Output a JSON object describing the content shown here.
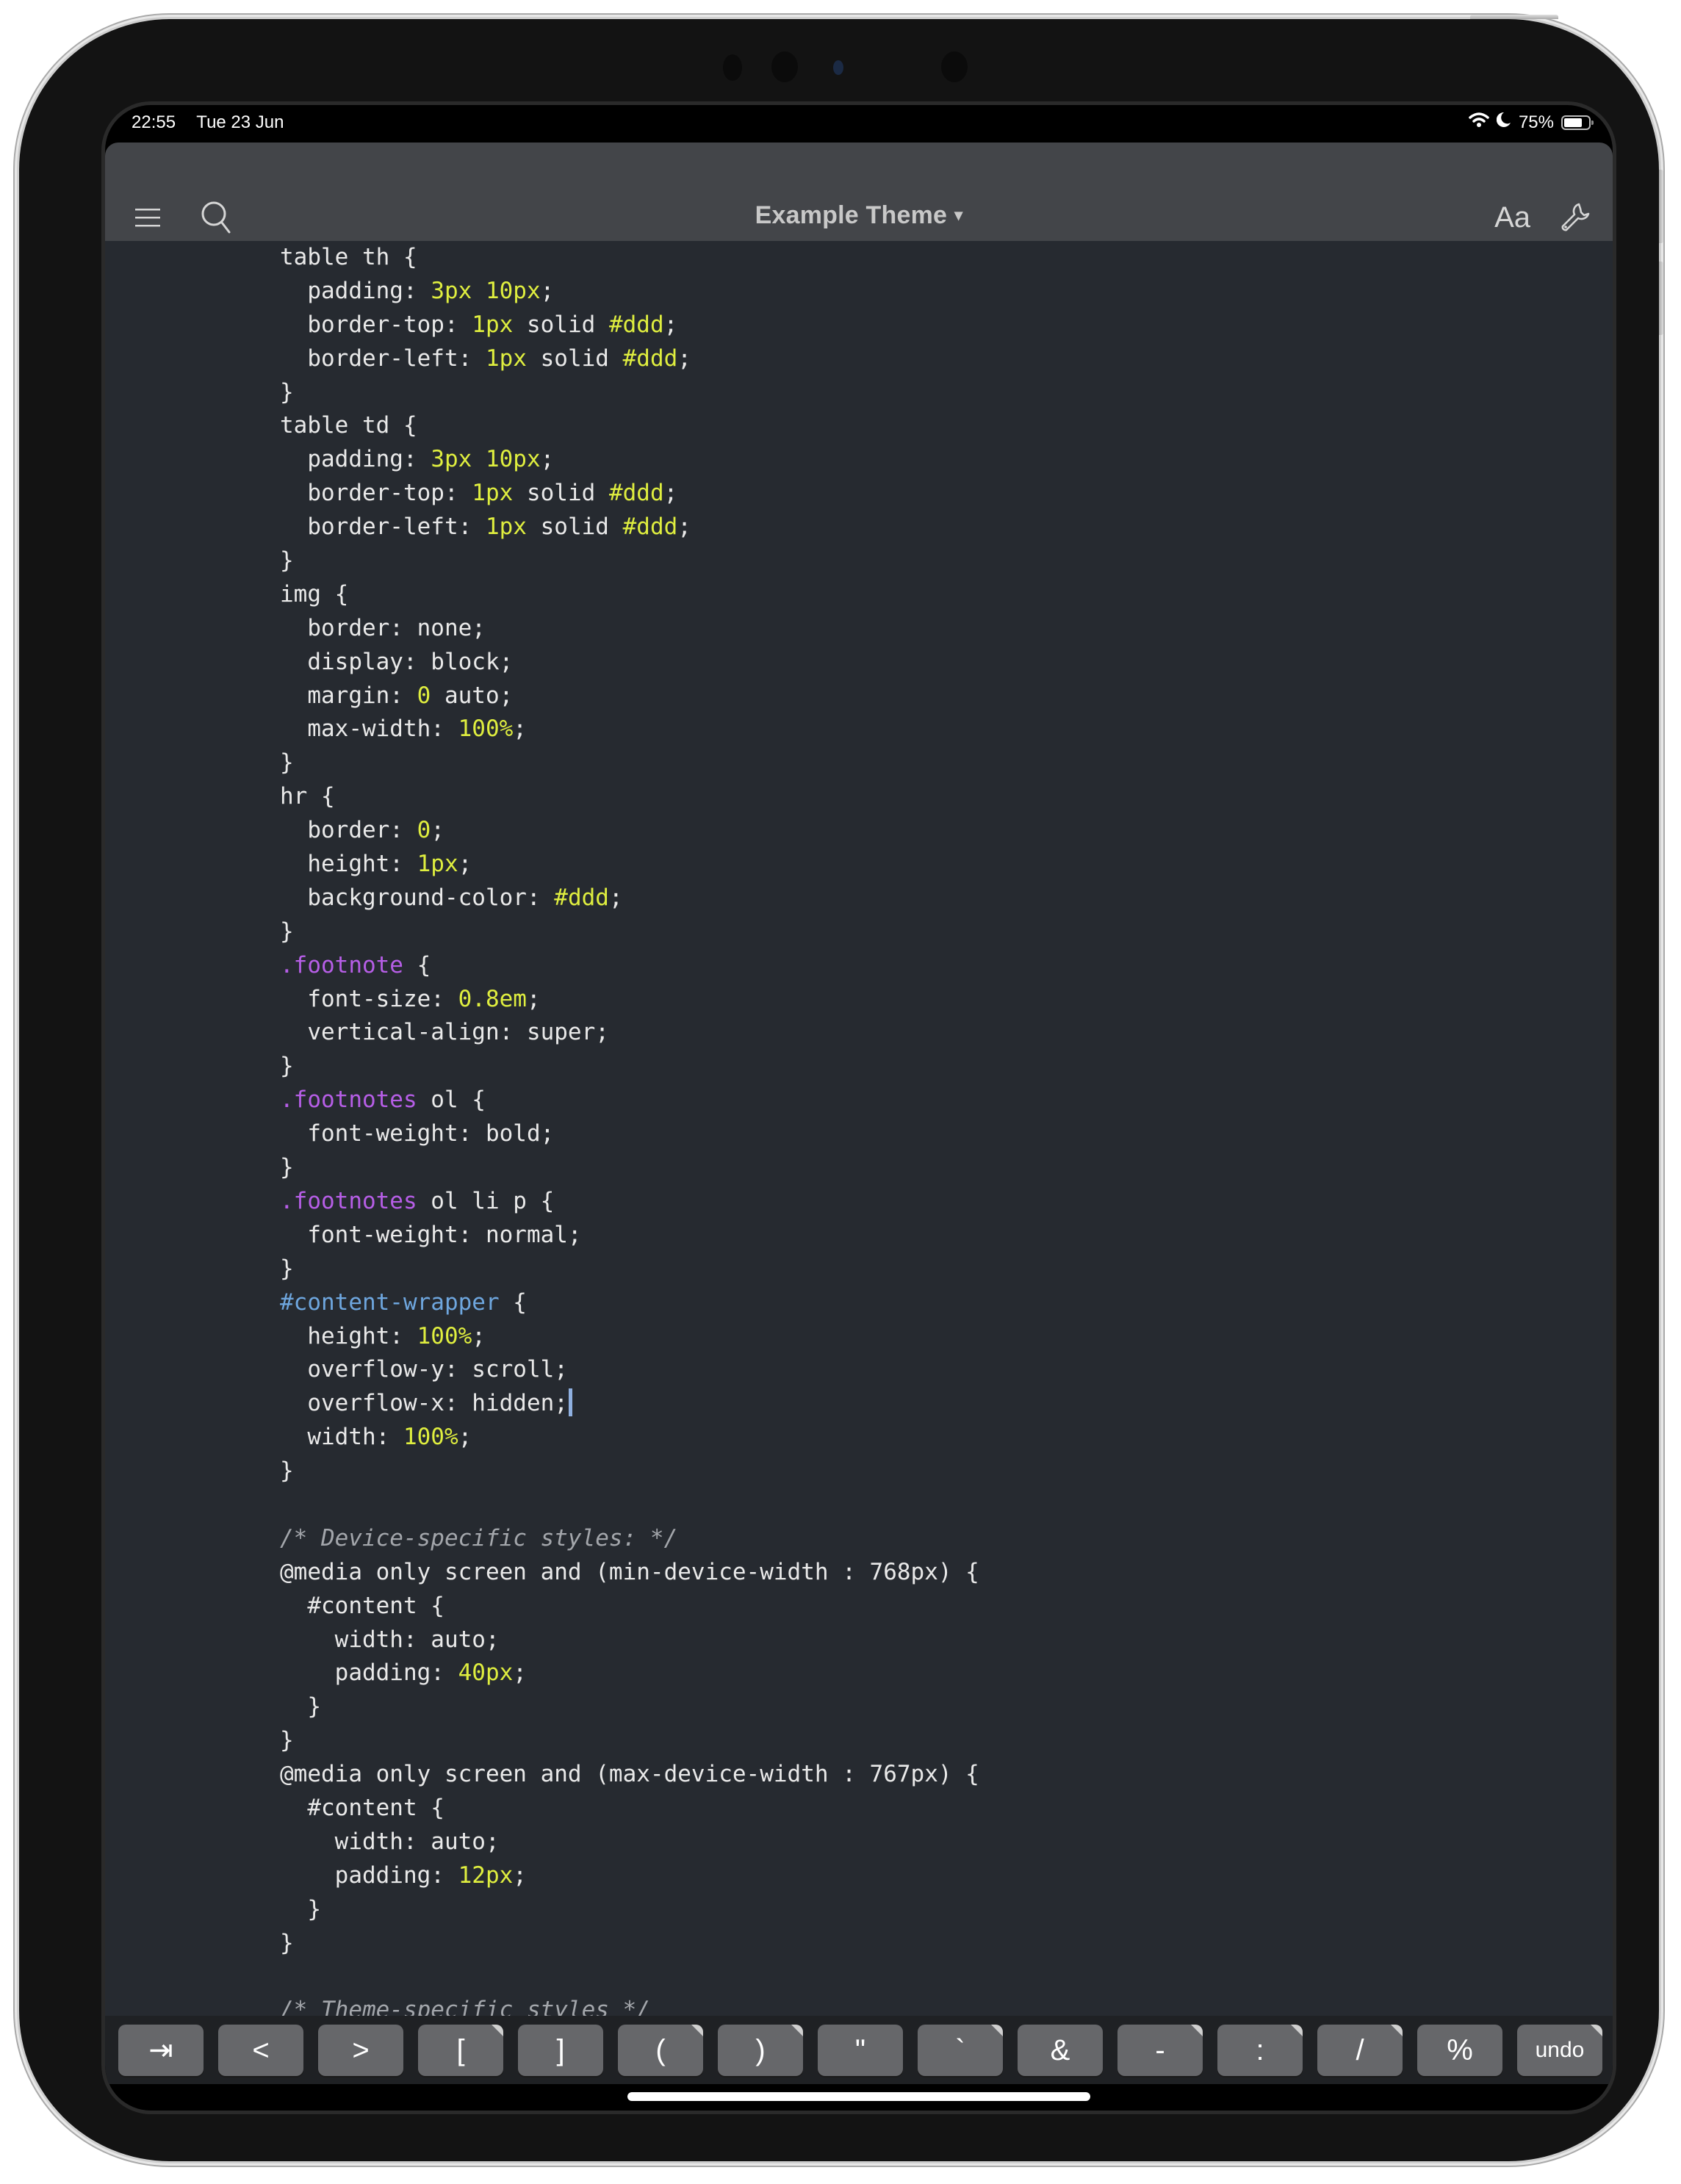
{
  "status_bar": {
    "time": "22:55",
    "date": "Tue 23 Jun",
    "battery_percent_label": "75%",
    "battery_level": 0.75,
    "icons": [
      "wifi-icon",
      "do-not-disturb-moon-icon",
      "battery-icon"
    ]
  },
  "toolbar": {
    "title": "Example Theme",
    "title_caret": "▾",
    "menu_icon": "hamburger-menu-icon",
    "search_icon": "search-icon",
    "font_button_label": "Aa",
    "settings_icon": "wrench-icon"
  },
  "editor": {
    "cursor_line": 35,
    "lines": [
      [
        {
          "t": "table th {",
          "c": "plain"
        }
      ],
      [
        {
          "t": "  padding: ",
          "c": "plain"
        },
        {
          "t": "3px 10px",
          "c": "num"
        },
        {
          "t": ";",
          "c": "plain"
        }
      ],
      [
        {
          "t": "  border-top: ",
          "c": "plain"
        },
        {
          "t": "1px",
          "c": "num"
        },
        {
          "t": " solid ",
          "c": "plain"
        },
        {
          "t": "#ddd",
          "c": "num"
        },
        {
          "t": ";",
          "c": "plain"
        }
      ],
      [
        {
          "t": "  border-left: ",
          "c": "plain"
        },
        {
          "t": "1px",
          "c": "num"
        },
        {
          "t": " solid ",
          "c": "plain"
        },
        {
          "t": "#ddd",
          "c": "num"
        },
        {
          "t": ";",
          "c": "plain"
        }
      ],
      [
        {
          "t": "}",
          "c": "plain"
        }
      ],
      [
        {
          "t": "table td {",
          "c": "plain"
        }
      ],
      [
        {
          "t": "  padding: ",
          "c": "plain"
        },
        {
          "t": "3px 10px",
          "c": "num"
        },
        {
          "t": ";",
          "c": "plain"
        }
      ],
      [
        {
          "t": "  border-top: ",
          "c": "plain"
        },
        {
          "t": "1px",
          "c": "num"
        },
        {
          "t": " solid ",
          "c": "plain"
        },
        {
          "t": "#ddd",
          "c": "num"
        },
        {
          "t": ";",
          "c": "plain"
        }
      ],
      [
        {
          "t": "  border-left: ",
          "c": "plain"
        },
        {
          "t": "1px",
          "c": "num"
        },
        {
          "t": " solid ",
          "c": "plain"
        },
        {
          "t": "#ddd",
          "c": "num"
        },
        {
          "t": ";",
          "c": "plain"
        }
      ],
      [
        {
          "t": "}",
          "c": "plain"
        }
      ],
      [
        {
          "t": "img {",
          "c": "plain"
        }
      ],
      [
        {
          "t": "  border: none;",
          "c": "plain"
        }
      ],
      [
        {
          "t": "  display: block;",
          "c": "plain"
        }
      ],
      [
        {
          "t": "  margin: ",
          "c": "plain"
        },
        {
          "t": "0",
          "c": "num"
        },
        {
          "t": " auto;",
          "c": "plain"
        }
      ],
      [
        {
          "t": "  max-width: ",
          "c": "plain"
        },
        {
          "t": "100%",
          "c": "num"
        },
        {
          "t": ";",
          "c": "plain"
        }
      ],
      [
        {
          "t": "}",
          "c": "plain"
        }
      ],
      [
        {
          "t": "hr {",
          "c": "plain"
        }
      ],
      [
        {
          "t": "  border: ",
          "c": "plain"
        },
        {
          "t": "0",
          "c": "num"
        },
        {
          "t": ";",
          "c": "plain"
        }
      ],
      [
        {
          "t": "  height: ",
          "c": "plain"
        },
        {
          "t": "1px",
          "c": "num"
        },
        {
          "t": ";",
          "c": "plain"
        }
      ],
      [
        {
          "t": "  background-color: ",
          "c": "plain"
        },
        {
          "t": "#ddd",
          "c": "num"
        },
        {
          "t": ";",
          "c": "plain"
        }
      ],
      [
        {
          "t": "}",
          "c": "plain"
        }
      ],
      [
        {
          "t": ".footnote",
          "c": "class"
        },
        {
          "t": " {",
          "c": "plain"
        }
      ],
      [
        {
          "t": "  font-size: ",
          "c": "plain"
        },
        {
          "t": "0.8em",
          "c": "num"
        },
        {
          "t": ";",
          "c": "plain"
        }
      ],
      [
        {
          "t": "  vertical-align: super;",
          "c": "plain"
        }
      ],
      [
        {
          "t": "}",
          "c": "plain"
        }
      ],
      [
        {
          "t": ".footnotes",
          "c": "class"
        },
        {
          "t": " ol {",
          "c": "plain"
        }
      ],
      [
        {
          "t": "  font-weight: bold;",
          "c": "plain"
        }
      ],
      [
        {
          "t": "}",
          "c": "plain"
        }
      ],
      [
        {
          "t": ".footnotes",
          "c": "class"
        },
        {
          "t": " ol li p {",
          "c": "plain"
        }
      ],
      [
        {
          "t": "  font-weight: normal;",
          "c": "plain"
        }
      ],
      [
        {
          "t": "}",
          "c": "plain"
        }
      ],
      [
        {
          "t": "#content-wrapper",
          "c": "id"
        },
        {
          "t": " {",
          "c": "plain"
        }
      ],
      [
        {
          "t": "  height: ",
          "c": "plain"
        },
        {
          "t": "100%",
          "c": "num"
        },
        {
          "t": ";",
          "c": "plain"
        }
      ],
      [
        {
          "t": "  overflow-y: scroll;",
          "c": "plain"
        }
      ],
      [
        {
          "t": "  overflow-x: hidden;",
          "c": "plain"
        }
      ],
      [
        {
          "t": "  width: ",
          "c": "plain"
        },
        {
          "t": "100%",
          "c": "num"
        },
        {
          "t": ";",
          "c": "plain"
        }
      ],
      [
        {
          "t": "}",
          "c": "plain"
        }
      ],
      [],
      [
        {
          "t": "/* Device-specific styles: */",
          "c": "comment"
        }
      ],
      [
        {
          "t": "@media only screen and (min-device-width : 768px) {",
          "c": "plain"
        }
      ],
      [
        {
          "t": "  #content {",
          "c": "plain"
        }
      ],
      [
        {
          "t": "    width: auto;",
          "c": "plain"
        }
      ],
      [
        {
          "t": "    padding: ",
          "c": "plain"
        },
        {
          "t": "40px",
          "c": "num"
        },
        {
          "t": ";",
          "c": "plain"
        }
      ],
      [
        {
          "t": "  }",
          "c": "plain"
        }
      ],
      [
        {
          "t": "}",
          "c": "plain"
        }
      ],
      [
        {
          "t": "@media only screen and (max-device-width : 767px) {",
          "c": "plain"
        }
      ],
      [
        {
          "t": "  #content {",
          "c": "plain"
        }
      ],
      [
        {
          "t": "    width: auto;",
          "c": "plain"
        }
      ],
      [
        {
          "t": "    padding: ",
          "c": "plain"
        },
        {
          "t": "12px",
          "c": "num"
        },
        {
          "t": ";",
          "c": "plain"
        }
      ],
      [
        {
          "t": "  }",
          "c": "plain"
        }
      ],
      [
        {
          "t": "}",
          "c": "plain"
        }
      ],
      [],
      [
        {
          "t": "/* Theme-specific styles */",
          "c": "comment"
        }
      ]
    ]
  },
  "keyboard_bar": {
    "keys": [
      {
        "label": "⇥",
        "name": "tab-key",
        "alt": false
      },
      {
        "label": "<",
        "name": "less-than-key",
        "alt": false
      },
      {
        "label": ">",
        "name": "greater-than-key",
        "alt": false
      },
      {
        "label": "[",
        "name": "open-bracket-key",
        "alt": true
      },
      {
        "label": "]",
        "name": "close-bracket-key",
        "alt": false
      },
      {
        "label": "(",
        "name": "open-paren-key",
        "alt": true
      },
      {
        "label": ")",
        "name": "close-paren-key",
        "alt": true
      },
      {
        "label": "\"",
        "name": "double-quote-key",
        "alt": false
      },
      {
        "label": "`",
        "name": "backtick-key",
        "alt": true
      },
      {
        "label": "&",
        "name": "ampersand-key",
        "alt": false
      },
      {
        "label": "-",
        "name": "hyphen-key",
        "alt": true
      },
      {
        "label": ":",
        "name": "colon-key",
        "alt": true
      },
      {
        "label": "/",
        "name": "slash-key",
        "alt": true
      },
      {
        "label": "%",
        "name": "percent-key",
        "alt": false
      },
      {
        "label": "undo",
        "name": "undo-key",
        "alt": true
      }
    ]
  },
  "colors": {
    "editor_bg": "#262a30",
    "toolbar_bg": "#434549",
    "text": "#e9e9e9",
    "number": "#dfee3f",
    "class_selector": "#b65ee6",
    "id_selector": "#6ea6de",
    "comment": "#a3a6ab",
    "cursor": "#8fb0e0",
    "key_bg": "#66676a"
  }
}
